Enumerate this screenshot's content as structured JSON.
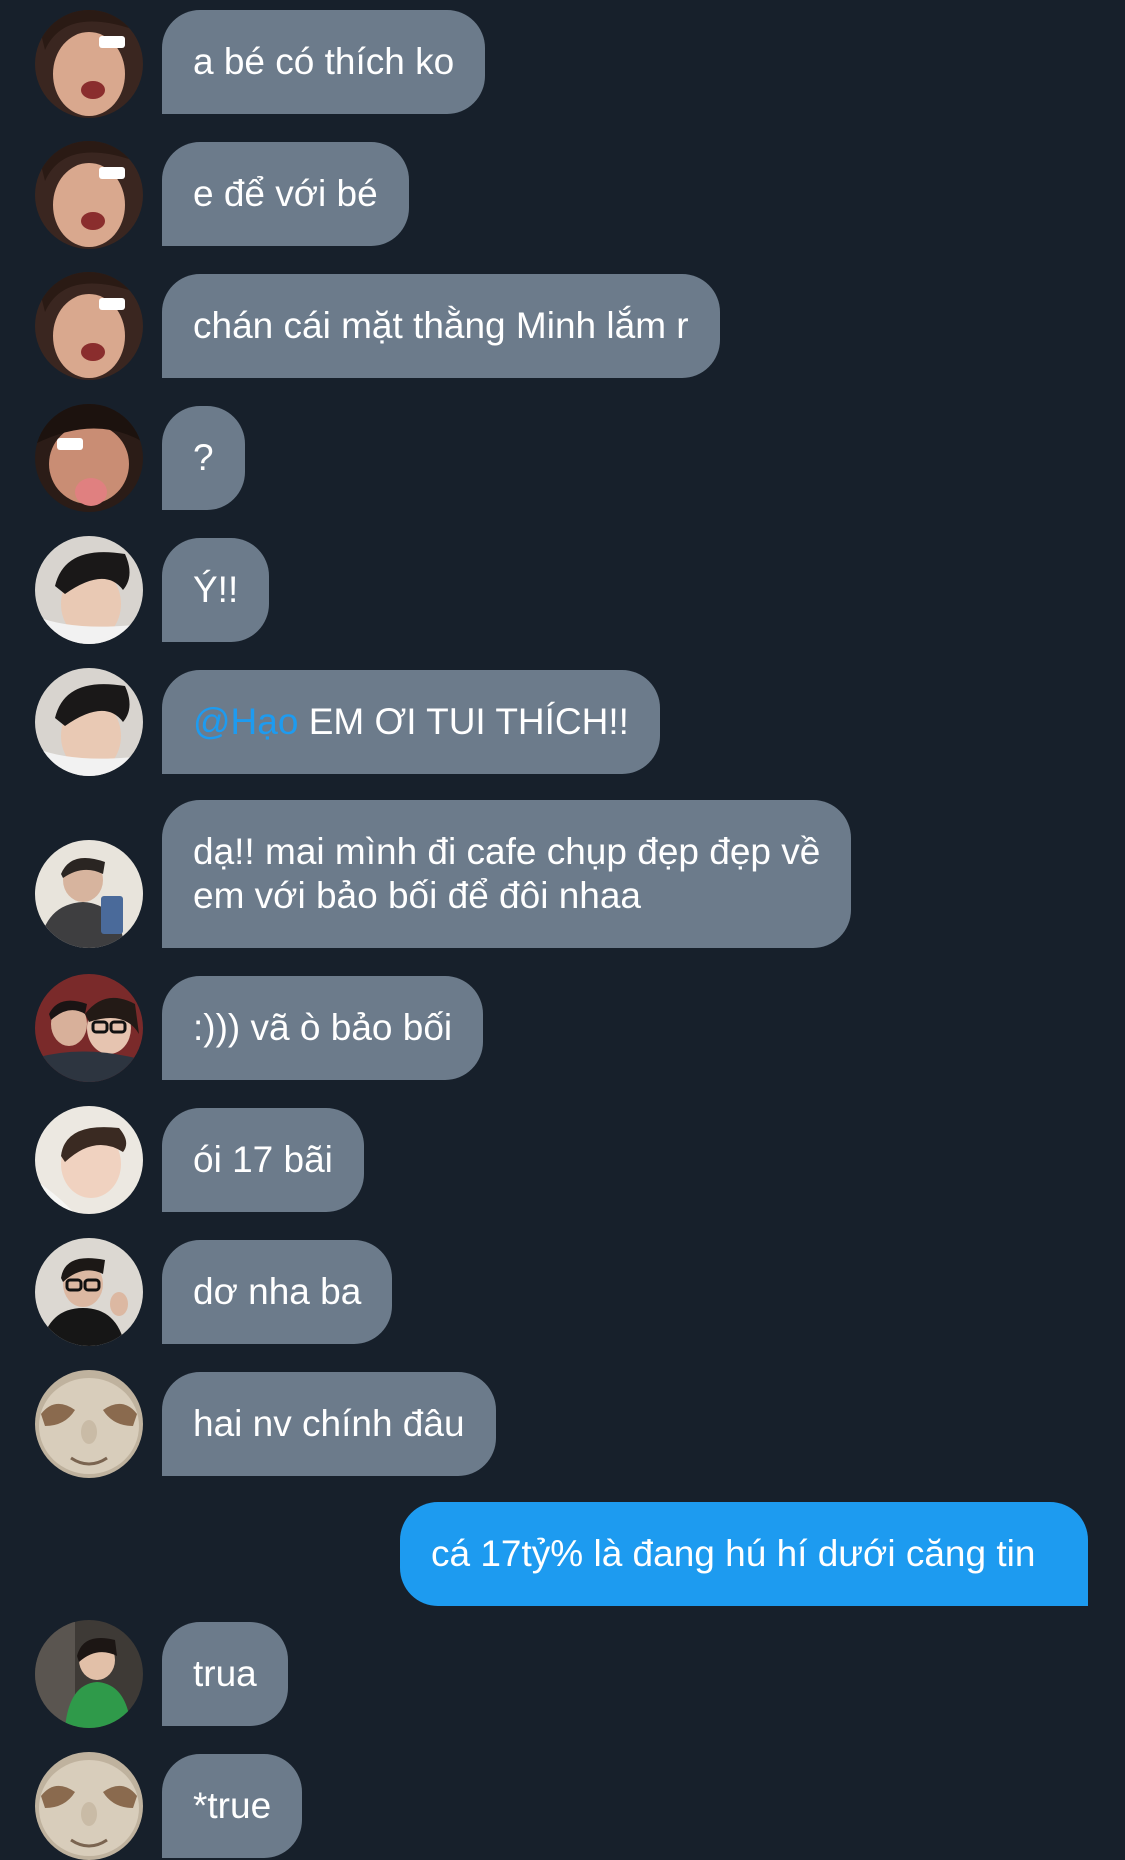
{
  "messages": [
    {
      "text": "a bé có thích ko",
      "avatar": "curly-hair-boy-avatar"
    },
    {
      "text": "e để với bé",
      "avatar": "curly-hair-boy-avatar"
    },
    {
      "text": "chán cái mặt thằng Minh lắm r",
      "avatar": "curly-hair-boy-avatar"
    },
    {
      "text": "?",
      "avatar": "tongue-out-avatar"
    },
    {
      "text": "Ý!!",
      "avatar": "dark-hair-boy-avatar"
    },
    {
      "mention": "@Hạo",
      "text": " EM ƠI TUI THÍCH!!",
      "avatar": "dark-hair-boy-avatar"
    },
    {
      "line1": "dạ!! mai mình đi cafe chụp đẹp đẹp về",
      "line2": "em với bảo bối để đôi nhaa",
      "avatar": "selfie-phone-avatar"
    },
    {
      "text": ":))) vã ò bảo bối",
      "avatar": "couple-glasses-avatar"
    },
    {
      "text": "ói 17 bãi",
      "avatar": "lying-boy-avatar"
    },
    {
      "text": "dơ nha ba",
      "avatar": "glasses-boy-avatar"
    },
    {
      "text": "hai nv chính đâu",
      "avatar": "cat-face-avatar"
    },
    {
      "text": "cá 17tỷ% là đang hú hí dưới căng tin",
      "mine": true
    },
    {
      "text": "trua",
      "avatar": "green-shirt-avatar"
    },
    {
      "text": "*true",
      "avatar": "cat-face-avatar"
    }
  ],
  "colors": {
    "background": "#17202b",
    "incoming_bubble": "#6c7b8b",
    "outgoing_bubble": "#1d9bf0",
    "mention": "#1d9bf0"
  }
}
